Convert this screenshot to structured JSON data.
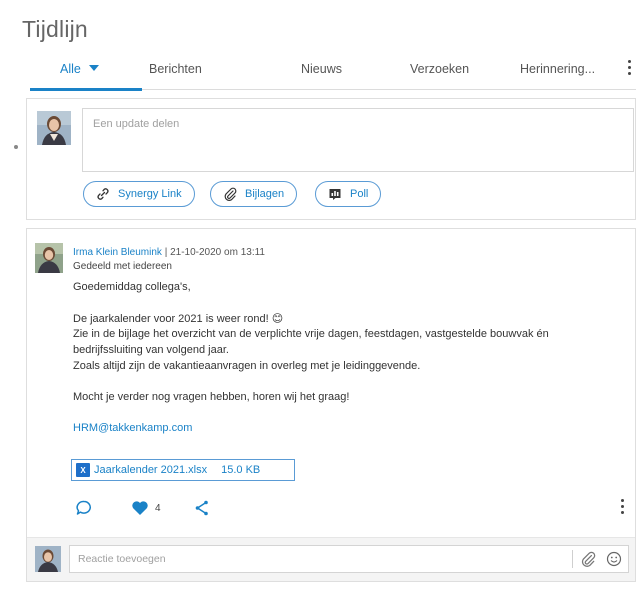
{
  "page": {
    "title": "Tijdlijn"
  },
  "tabs": [
    {
      "label": "Alle"
    },
    {
      "label": "Berichten"
    },
    {
      "label": "Nieuws"
    },
    {
      "label": "Verzoeken"
    },
    {
      "label": "Herinnering..."
    }
  ],
  "composer": {
    "placeholder": "Een update delen",
    "buttons": {
      "synergy_link": "Synergy Link",
      "bijlagen": "Bijlagen",
      "poll": "Poll"
    }
  },
  "post": {
    "author": "Irma Klein Bleumink",
    "separator": "|",
    "timestamp": "21-10-2020 om 13:11",
    "shared_with": "Gedeeld met iedereen",
    "lines": [
      "Goedemiddag collega's,",
      "De jaarkalender voor 2021 is weer rond! 😊",
      "Zie in de bijlage het overzicht van de verplichte vrije dagen, feestdagen, vastgestelde bouwvak én",
      "bedrijfssluiting van volgend jaar.",
      "Zoals altijd zijn de vakantieaanvragen in overleg met je leidinggevende.",
      "Mocht je verder nog vragen hebben, horen wij het graag!"
    ],
    "email": "HRM@takkenkamp.com",
    "attachment": {
      "icon_text": "X",
      "name": "Jaarkalender 2021.xlsx",
      "size": "15.0 KB"
    },
    "likes": "4"
  },
  "comment": {
    "placeholder": "Reactie toevoegen"
  },
  "colors": {
    "accent": "#1a82c7",
    "border": "#dedede"
  },
  "icons": [
    "chevron-down-icon",
    "more-vertical-icon",
    "link-icon",
    "paperclip-icon",
    "poll-icon",
    "comment-icon",
    "heart-icon",
    "share-icon",
    "excel-file-icon",
    "smiley-icon"
  ]
}
